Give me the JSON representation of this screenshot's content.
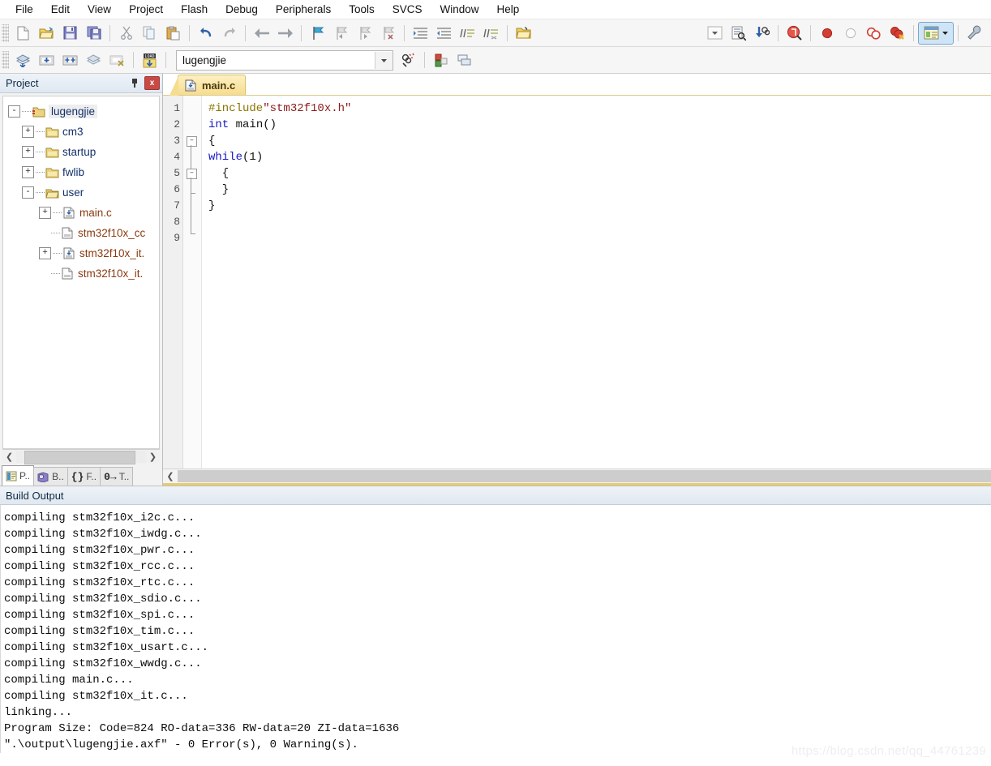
{
  "menubar": {
    "items": [
      {
        "label": "File"
      },
      {
        "label": "Edit"
      },
      {
        "label": "View"
      },
      {
        "label": "Project"
      },
      {
        "label": "Flash"
      },
      {
        "label": "Debug"
      },
      {
        "label": "Peripherals"
      },
      {
        "label": "Tools"
      },
      {
        "label": "SVCS"
      },
      {
        "label": "Window"
      },
      {
        "label": "Help"
      }
    ]
  },
  "toolbar_main": {
    "buttons": [
      {
        "name": "new-file-icon",
        "title": "New"
      },
      {
        "name": "open-file-icon",
        "title": "Open"
      },
      {
        "name": "save-icon",
        "title": "Save"
      },
      {
        "name": "save-all-icon",
        "title": "Save All"
      },
      {
        "name": "cut-icon",
        "title": "Cut"
      },
      {
        "name": "copy-icon",
        "title": "Copy"
      },
      {
        "name": "paste-icon",
        "title": "Paste"
      },
      {
        "name": "undo-icon",
        "title": "Undo"
      },
      {
        "name": "redo-icon",
        "title": "Redo"
      },
      {
        "name": "navigate-back-icon",
        "title": "Back"
      },
      {
        "name": "navigate-forward-icon",
        "title": "Forward"
      },
      {
        "name": "bookmark-toggle-icon",
        "title": "Insert/Remove Bookmark"
      },
      {
        "name": "bookmark-prev-icon",
        "title": "Previous Bookmark"
      },
      {
        "name": "bookmark-next-icon",
        "title": "Next Bookmark"
      },
      {
        "name": "bookmark-clear-icon",
        "title": "Clear All Bookmarks"
      },
      {
        "name": "indent-icon",
        "title": "Indent Selected Text"
      },
      {
        "name": "outdent-icon",
        "title": "Outdent Selected Text"
      },
      {
        "name": "comment-icon",
        "title": "Comment Selection"
      },
      {
        "name": "uncomment-icon",
        "title": "Uncomment Selection"
      },
      {
        "name": "open-folder-icon",
        "title": "Open Containing Folder"
      },
      {
        "name": "dropdown-icon",
        "title": "Find Combo"
      },
      {
        "name": "find-in-files-icon",
        "title": "Find in Files"
      },
      {
        "name": "bookmark-search-icon",
        "title": "Find Next"
      },
      {
        "name": "start-debug-icon",
        "title": "Start/Stop Debug Session"
      },
      {
        "name": "breakpoint-insert-icon",
        "title": "Insert/Remove Breakpoint"
      },
      {
        "name": "breakpoint-disable-icon",
        "title": "Enable/Disable Breakpoint"
      },
      {
        "name": "breakpoint-disable-all-icon",
        "title": "Disable All Breakpoints"
      },
      {
        "name": "breakpoint-kill-all-icon",
        "title": "Kill All Breakpoints"
      },
      {
        "name": "window-panes-icon",
        "title": "Manage Window Panes"
      },
      {
        "name": "configure-icon",
        "title": "Configuration Wizard"
      }
    ]
  },
  "toolbar_build": {
    "buttons": [
      {
        "name": "translate-icon",
        "title": "Translate"
      },
      {
        "name": "build-icon",
        "title": "Build"
      },
      {
        "name": "rebuild-icon",
        "title": "Rebuild"
      },
      {
        "name": "batch-build-icon",
        "title": "Batch Build"
      },
      {
        "name": "stop-build-icon",
        "title": "Stop Build"
      },
      {
        "name": "download-icon",
        "title": "Download"
      }
    ],
    "target_value": "lugengjie",
    "after_buttons": [
      {
        "name": "target-options-icon",
        "title": "Options for Target"
      },
      {
        "name": "manage-project-items-icon",
        "title": "Manage Project Items"
      },
      {
        "name": "manage-layers-icon",
        "title": "Manage Run-Time Environment"
      }
    ]
  },
  "project_panel": {
    "title": "Project",
    "pin_icon": "pin-icon",
    "close_label": "x",
    "tree": [
      {
        "level": 1,
        "toggle": "-",
        "icon": "project-folder-icon",
        "label": "lugengjie",
        "type": "root"
      },
      {
        "level": 2,
        "toggle": "+",
        "icon": "folder-icon",
        "label": "cm3",
        "type": "folder"
      },
      {
        "level": 2,
        "toggle": "+",
        "icon": "folder-icon",
        "label": "startup",
        "type": "folder"
      },
      {
        "level": 2,
        "toggle": "+",
        "icon": "folder-icon",
        "label": "fwlib",
        "type": "folder"
      },
      {
        "level": 2,
        "toggle": "-",
        "icon": "folder-open-icon",
        "label": "user",
        "type": "folder"
      },
      {
        "level": 3,
        "toggle": "+",
        "icon": "c-file-icon",
        "label": "main.c",
        "type": "file"
      },
      {
        "level": 3,
        "toggle": "",
        "icon": "h-file-icon",
        "label": "stm32f10x_cc",
        "type": "file"
      },
      {
        "level": 3,
        "toggle": "+",
        "icon": "c-file-icon",
        "label": "stm32f10x_it.",
        "type": "file"
      },
      {
        "level": 3,
        "toggle": "",
        "icon": "h-file-icon",
        "label": "stm32f10x_it.",
        "type": "file"
      }
    ],
    "tabs": [
      {
        "name": "tab-project",
        "icon": "project-window-icon",
        "label": "P..",
        "selected": true
      },
      {
        "name": "tab-books",
        "icon": "books-icon",
        "label": "B..",
        "selected": false
      },
      {
        "name": "tab-functions",
        "icon": "functions-icon",
        "label": "F..",
        "selected": false
      },
      {
        "name": "tab-templates",
        "icon": "templates-icon",
        "label": "T..",
        "selected": false
      }
    ]
  },
  "editor": {
    "tabs": [
      {
        "name": "editor-tab-main-c",
        "icon": "c-file-icon",
        "label": "main.c",
        "active": true
      }
    ],
    "line_numbers": [
      "1",
      "2",
      "3",
      "4",
      "5",
      "6",
      "7",
      "8",
      "9"
    ],
    "lines": [
      {
        "n": "1",
        "segments": [
          {
            "t": "#include",
            "c": "pre"
          },
          {
            "t": "\"stm32f10x.h\"",
            "c": "str"
          }
        ]
      },
      {
        "n": "2",
        "segments": [
          {
            "t": "int",
            "c": "key"
          },
          {
            "t": " main()",
            "c": "plain"
          }
        ]
      },
      {
        "n": "3",
        "segments": [
          {
            "t": "{",
            "c": "plain"
          }
        ]
      },
      {
        "n": "4",
        "segments": [
          {
            "t": "while",
            "c": "key"
          },
          {
            "t": "(1)",
            "c": "plain"
          }
        ]
      },
      {
        "n": "5",
        "segments": [
          {
            "t": "  {",
            "c": "plain"
          }
        ]
      },
      {
        "n": "6",
        "segments": [
          {
            "t": "  }",
            "c": "plain"
          }
        ]
      },
      {
        "n": "7",
        "segments": [
          {
            "t": "}",
            "c": "plain"
          }
        ]
      },
      {
        "n": "8",
        "segments": []
      },
      {
        "n": "9",
        "segments": []
      }
    ]
  },
  "build_output": {
    "title": "Build Output",
    "lines": [
      "compiling stm32f10x_i2c.c...",
      "compiling stm32f10x_iwdg.c...",
      "compiling stm32f10x_pwr.c...",
      "compiling stm32f10x_rcc.c...",
      "compiling stm32f10x_rtc.c...",
      "compiling stm32f10x_sdio.c...",
      "compiling stm32f10x_spi.c...",
      "compiling stm32f10x_tim.c...",
      "compiling stm32f10x_usart.c...",
      "compiling stm32f10x_wwdg.c...",
      "compiling main.c...",
      "compiling stm32f10x_it.c...",
      "linking...",
      "Program Size: Code=824 RO-data=336 RW-data=20 ZI-data=1636",
      "\".\\output\\lugengjie.axf\" - 0 Error(s), 0 Warning(s)."
    ]
  },
  "watermark": {
    "text": "https://blog.csdn.net/qq_44761239"
  },
  "colors": {
    "tab_gold": "#f6dc8e",
    "accent_blue": "#1616c8",
    "preproc": "#8a7500",
    "string": "#8b1a1a",
    "close_red": "#c94a45"
  }
}
